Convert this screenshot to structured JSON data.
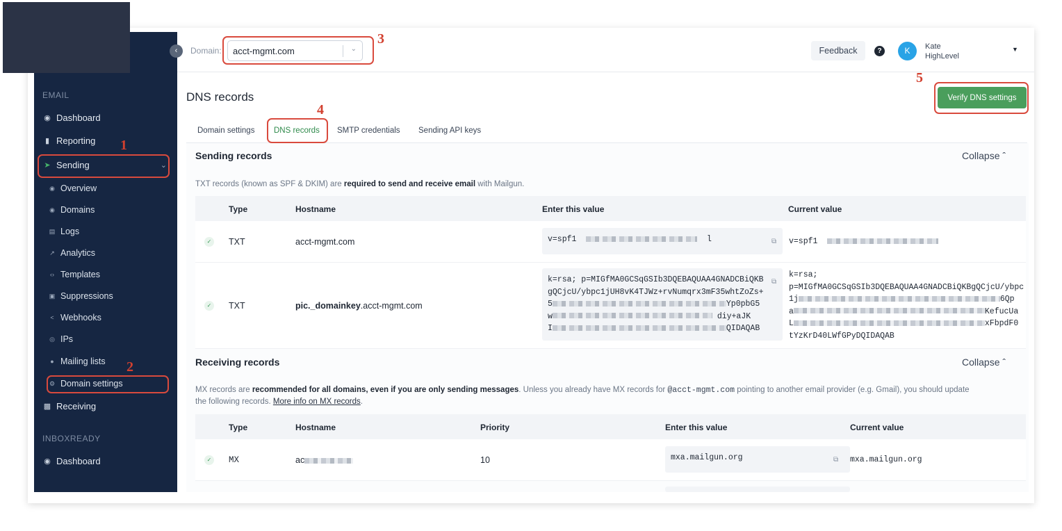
{
  "header": {
    "domain_label": "Domain:",
    "domain_value": "acct-mgmt.com",
    "feedback_label": "Feedback",
    "help_label": "?",
    "user_initial": "K",
    "user_first": "Kate",
    "user_org": "HighLevel"
  },
  "sidebar": {
    "section_email": "EMAIL",
    "dashboard": "Dashboard",
    "reporting": "Reporting",
    "sending": "Sending",
    "sub": {
      "overview": "Overview",
      "domains": "Domains",
      "logs": "Logs",
      "analytics": "Analytics",
      "templates": "Templates",
      "suppressions": "Suppressions",
      "webhooks": "Webhooks",
      "ips": "IPs",
      "mailing_lists": "Mailing lists",
      "domain_settings": "Domain settings"
    },
    "receiving": "Receiving",
    "section_inbox": "INBOXREADY",
    "inbox_dashboard": "Dashboard"
  },
  "annotations": {
    "n1": "1",
    "n2": "2",
    "n3": "3",
    "n4": "4",
    "n5": "5"
  },
  "page": {
    "title": "DNS records",
    "verify_button": "Verify DNS settings",
    "tabs": [
      "Domain settings",
      "DNS records",
      "SMTP credentials",
      "Sending API keys"
    ],
    "active_tab": "DNS records"
  },
  "sending": {
    "title": "Sending records",
    "collapse": "Collapse",
    "desc_pre": "TXT records (known as SPF & DKIM) are ",
    "desc_bold": "required to send and receive email",
    "desc_post": " with Mailgun.",
    "headers": [
      "Type",
      "Hostname",
      "Enter this value",
      "Current value"
    ],
    "rows": [
      {
        "type": "TXT",
        "hostname": "acct-mgmt.com",
        "value_start": "v=spf1",
        "value_end": "l",
        "current_start": "v=spf1"
      },
      {
        "type": "TXT",
        "hostname_bold": "pic._domainkey",
        "hostname_rest": ".acct-mgmt.com",
        "value_l1": "k=rsa; p=MIGfMA0GCSqGSIb3DQEBAQUAA4GNADCBiQKB",
        "value_l2": "gQCjcU/ybpc1jUH8vK4TJWz+rvNumqrx3mF35whtZoZs+",
        "value_l3_start": "5",
        "value_l3_end": "Yp0pbG5",
        "value_l4_start": "w",
        "value_l4_end": "diy+aJK",
        "value_l5_start": "I",
        "value_l5_end": "QIDAQAB",
        "current_l1": "k=rsa;",
        "current_l2": "p=MIGfMA0GCSqGSIb3DQEBAQUAA4GNADCBiQKBgQCjcU/ybpc",
        "current_l3_start": "1j",
        "current_l3_end": "6Qp",
        "current_l4_start": "a",
        "current_l4_end": "KefucUa",
        "current_l5_start": "L",
        "current_l5_end": "xFbpdF0",
        "current_l6": "tYzKrD40LWfGPyDQIDAQAB"
      }
    ]
  },
  "receiving": {
    "title": "Receiving records",
    "collapse": "Collapse",
    "desc_1": "MX records are ",
    "desc_bold": "recommended for all domains, even if you are only sending messages",
    "desc_2": ". Unless you already have MX records for ",
    "desc_mono": "@acct-mgmt.com",
    "desc_3": " pointing to another email provider (e.g. Gmail), you should update",
    "desc_4": "the following records. ",
    "desc_link": "More info on MX records",
    "desc_5": ".",
    "headers": [
      "Type",
      "Hostname",
      "Priority",
      "Enter this value",
      "Current value"
    ],
    "rows": [
      {
        "type": "MX",
        "hostname_start": "ac",
        "priority": "10",
        "value": "mxa.mailgun.org",
        "current": "mxa.mailgun.org"
      }
    ]
  }
}
